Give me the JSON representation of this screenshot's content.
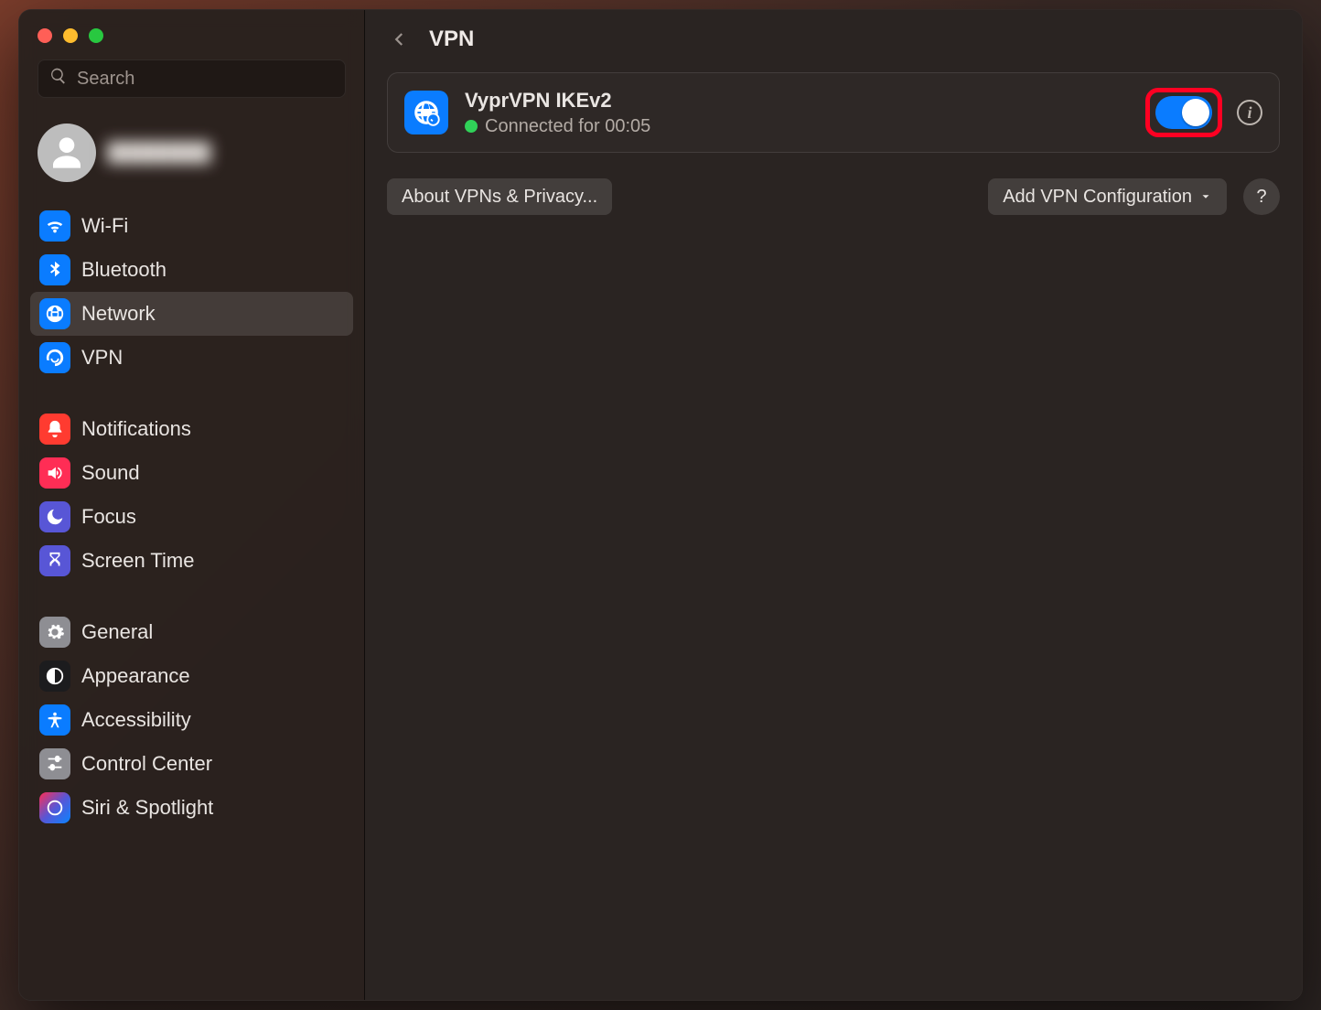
{
  "title": "VPN",
  "search": {
    "placeholder": "Search"
  },
  "user": {
    "name": "████████"
  },
  "sidebar": {
    "items": [
      {
        "id": "wifi",
        "label": "Wi-Fi"
      },
      {
        "id": "bluetooth",
        "label": "Bluetooth"
      },
      {
        "id": "network",
        "label": "Network"
      },
      {
        "id": "vpn",
        "label": "VPN"
      },
      {
        "id": "notifications",
        "label": "Notifications"
      },
      {
        "id": "sound",
        "label": "Sound"
      },
      {
        "id": "focus",
        "label": "Focus"
      },
      {
        "id": "screentime",
        "label": "Screen Time"
      },
      {
        "id": "general",
        "label": "General"
      },
      {
        "id": "appearance",
        "label": "Appearance"
      },
      {
        "id": "accessibility",
        "label": "Accessibility"
      },
      {
        "id": "controlcenter",
        "label": "Control Center"
      },
      {
        "id": "siri",
        "label": "Siri & Spotlight"
      }
    ],
    "selected_id": "network"
  },
  "vpn": {
    "name": "VyprVPN IKEv2",
    "status": "Connected for 00:05",
    "enabled": true
  },
  "buttons": {
    "about": "About VPNs & Privacy...",
    "add": "Add VPN Configuration",
    "help": "?"
  }
}
